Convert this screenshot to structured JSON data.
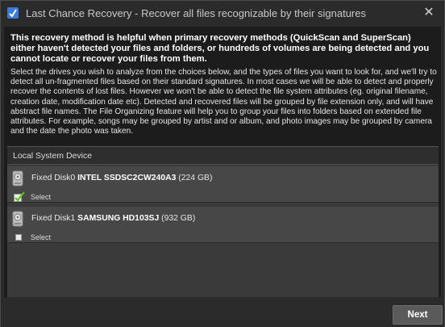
{
  "window": {
    "title": "Last Chance Recovery - Recover all files recognizable by their signatures"
  },
  "intro": {
    "bold": "This recovery method is helpful when primary recovery methods (QuickScan and SuperScan) either haven't detected your files and folders, or hundreds of volumes are being detected and you cannot locate or recover your files from them.",
    "body": "Select the drives you wish to analyze from the choices below, and the types of files you want to look for, and we'll try to detect all un-fragmented files based on their standard signatures. In most cases we will be able to detect and properly recover the contents of lost files. However we won't be able to detect the file system attributes (eg. original filename, creation date, modification date etc). Detected and recovered files will be grouped by file extension only, and will have abstract file names. The File Organizing feature will help you to group your files into folders based on extended file attributes. For example, songs may be grouped by artist and or album, and photo images may be grouped by camera and the date the photo was taken."
  },
  "devices": {
    "header": "Local System Device",
    "items": [
      {
        "prefix": "Fixed Disk0 ",
        "name": "INTEL SSDSC2CW240A3",
        "size": " (224 GB)",
        "select_label": "Select",
        "selected": true
      },
      {
        "prefix": "Fixed Disk1 ",
        "name": "SAMSUNG HD103SJ",
        "size": " (932 GB)",
        "select_label": "Select",
        "selected": false
      }
    ]
  },
  "footer": {
    "next_label": "Next"
  },
  "colors": {
    "check": "#5cc21c",
    "background": "#1c1c1c"
  }
}
